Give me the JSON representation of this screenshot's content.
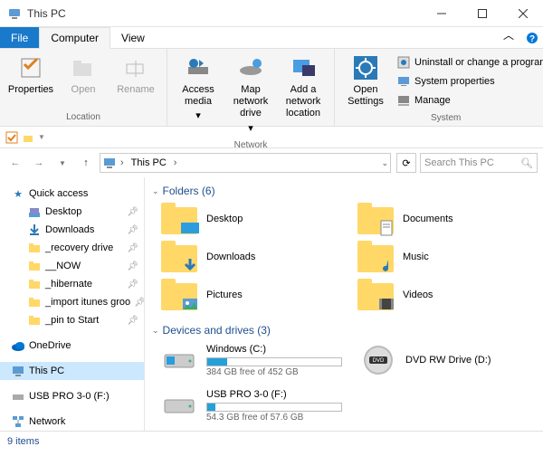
{
  "title": "This PC",
  "tabs": {
    "file": "File",
    "computer": "Computer",
    "view": "View"
  },
  "ribbon": {
    "location": {
      "label": "Location",
      "properties": "Properties",
      "open": "Open",
      "rename": "Rename"
    },
    "network": {
      "label": "Network",
      "access": "Access media",
      "map": "Map network drive",
      "add": "Add a network location"
    },
    "system": {
      "label": "System",
      "open": "Open Settings",
      "uninstall": "Uninstall or change a program",
      "props": "System properties",
      "manage": "Manage"
    }
  },
  "address": {
    "location": "This PC",
    "search_placeholder": "Search This PC"
  },
  "sidebar": {
    "quick": "Quick access",
    "items": [
      "Desktop",
      "Downloads",
      "_recovery drive",
      "__NOW",
      "_hibernate",
      "_import itunes groo",
      "_pin to Start"
    ],
    "onedrive": "OneDrive",
    "thispc": "This PC",
    "usb": "USB PRO 3-0 (F:)",
    "network": "Network"
  },
  "sections": {
    "folders": "Folders (6)",
    "drives": "Devices and drives (3)"
  },
  "folders": [
    {
      "name": "Desktop",
      "overlay": "desktop"
    },
    {
      "name": "Documents",
      "overlay": "doc"
    },
    {
      "name": "Downloads",
      "overlay": "down"
    },
    {
      "name": "Music",
      "overlay": "music"
    },
    {
      "name": "Pictures",
      "overlay": "pic"
    },
    {
      "name": "Videos",
      "overlay": "video"
    }
  ],
  "drives": [
    {
      "name": "Windows (C:)",
      "free": "384 GB free of 452 GB",
      "pct": 15,
      "type": "hdd"
    },
    {
      "name": "DVD RW Drive (D:)",
      "type": "dvd"
    },
    {
      "name": "USB PRO 3-0 (F:)",
      "free": "54.3 GB free of 57.6 GB",
      "pct": 6,
      "type": "hdd"
    }
  ],
  "status": "9 items"
}
